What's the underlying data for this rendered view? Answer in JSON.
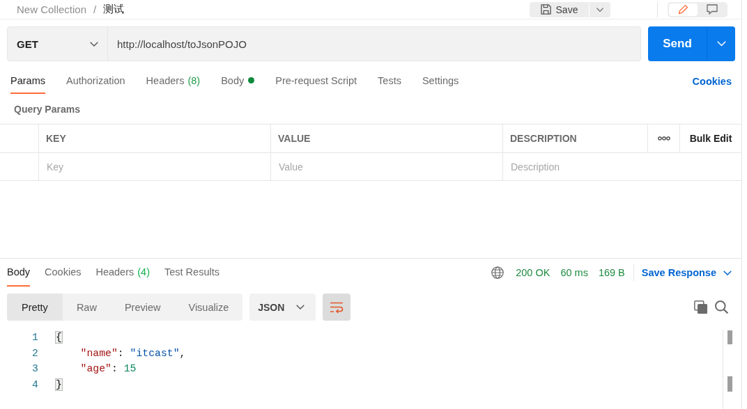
{
  "breadcrumb": {
    "collection": "New Collection",
    "separator": "/",
    "request": "测试"
  },
  "toolbar": {
    "save_label": "Save",
    "modes": [
      {
        "kind": "edit",
        "selected": true
      },
      {
        "kind": "comment",
        "selected": false
      }
    ]
  },
  "request": {
    "method": "GET",
    "url": "http://localhost/toJsonPOJO",
    "send_label": "Send"
  },
  "request_tabs": [
    {
      "label": "Params",
      "selected": true
    },
    {
      "label": "Authorization",
      "selected": false
    },
    {
      "label": "Headers",
      "count": "(8)",
      "selected": false
    },
    {
      "label": "Body",
      "dot": true,
      "selected": false
    },
    {
      "label": "Pre-request Script",
      "selected": false
    },
    {
      "label": "Tests",
      "selected": false
    },
    {
      "label": "Settings",
      "selected": false
    }
  ],
  "cookies_link": "Cookies",
  "query_params": {
    "title": "Query Params",
    "columns": [
      "KEY",
      "VALUE",
      "DESCRIPTION"
    ],
    "bulk_edit_label": "Bulk Edit",
    "placeholders": [
      "Key",
      "Value",
      "Description"
    ]
  },
  "response": {
    "tabs": [
      {
        "label": "Body",
        "selected": true
      },
      {
        "label": "Cookies",
        "selected": false
      },
      {
        "label": "Headers",
        "count": "(4)",
        "selected": false
      },
      {
        "label": "Test Results",
        "selected": false
      }
    ],
    "status": "200 OK",
    "time": "60 ms",
    "size": "169 B",
    "save_label": "Save Response",
    "formats": [
      {
        "label": "Pretty",
        "selected": true
      },
      {
        "label": "Raw",
        "selected": false
      },
      {
        "label": "Preview",
        "selected": false
      },
      {
        "label": "Visualize",
        "selected": false
      }
    ],
    "language": "JSON",
    "line_wrap": {
      "on": true
    },
    "code_lines": [
      {
        "number": "1",
        "tokens": [
          {
            "kind": "bracket",
            "text": "{",
            "matched": true
          }
        ],
        "children": [
          {
            "number": "2",
            "tokens": [
              {
                "kind": "key",
                "text": "\"name\""
              },
              {
                "kind": "punct",
                "text": ": "
              },
              {
                "kind": "string",
                "text": "\"itcast\""
              },
              {
                "kind": "punct",
                "text": ","
              }
            ]
          },
          {
            "number": "3",
            "tokens": [
              {
                "kind": "key",
                "text": "\"age\""
              },
              {
                "kind": "punct",
                "text": ": "
              },
              {
                "kind": "number",
                "text": "15"
              }
            ]
          }
        ]
      },
      {
        "number": "4",
        "tokens": [
          {
            "kind": "bracket",
            "text": "}",
            "matched": true
          }
        ]
      }
    ]
  }
}
